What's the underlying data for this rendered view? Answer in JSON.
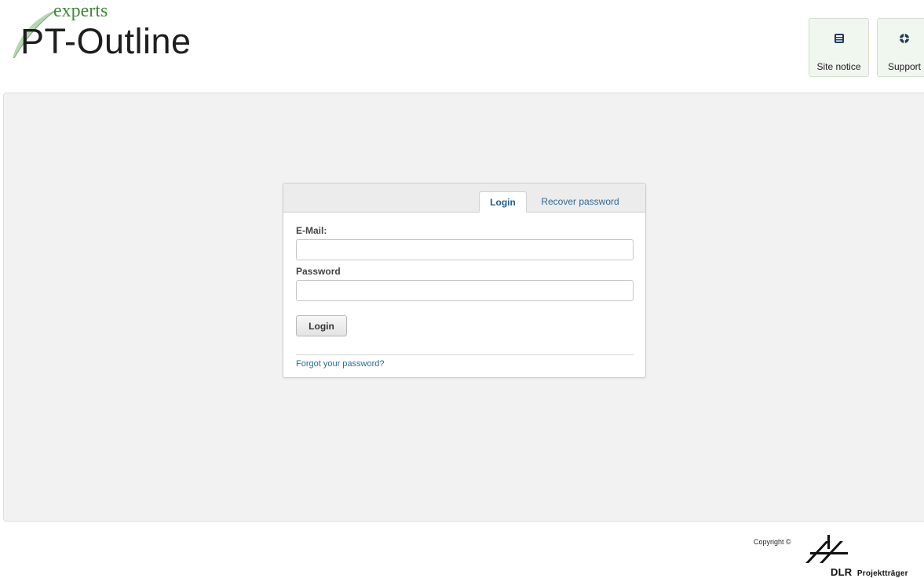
{
  "logo": {
    "subtitle": "experts",
    "title": "PT-Outline"
  },
  "header_buttons": {
    "site_notice": {
      "label": "Site notice",
      "icon": "site-notice-icon"
    },
    "support": {
      "label": "Support",
      "icon": "lifebuoy-icon"
    }
  },
  "login_box": {
    "tabs": [
      {
        "label": "Login",
        "active": true
      },
      {
        "label": "Recover password",
        "active": false
      }
    ],
    "email_label": "E-Mail:",
    "email_value": "",
    "password_label": "Password",
    "password_value": "",
    "login_button": "Login",
    "forgot_link": "Forgot your password?"
  },
  "footer": {
    "copyright": "Copyright ©",
    "brand_abbr": "DLR",
    "brand_name": "Projektträger"
  },
  "colors": {
    "logo_green": "#3f8a3a",
    "link_blue": "#2a6a98",
    "button_bg": "#f0f7ef",
    "panel_bg": "#f2f2f2"
  }
}
